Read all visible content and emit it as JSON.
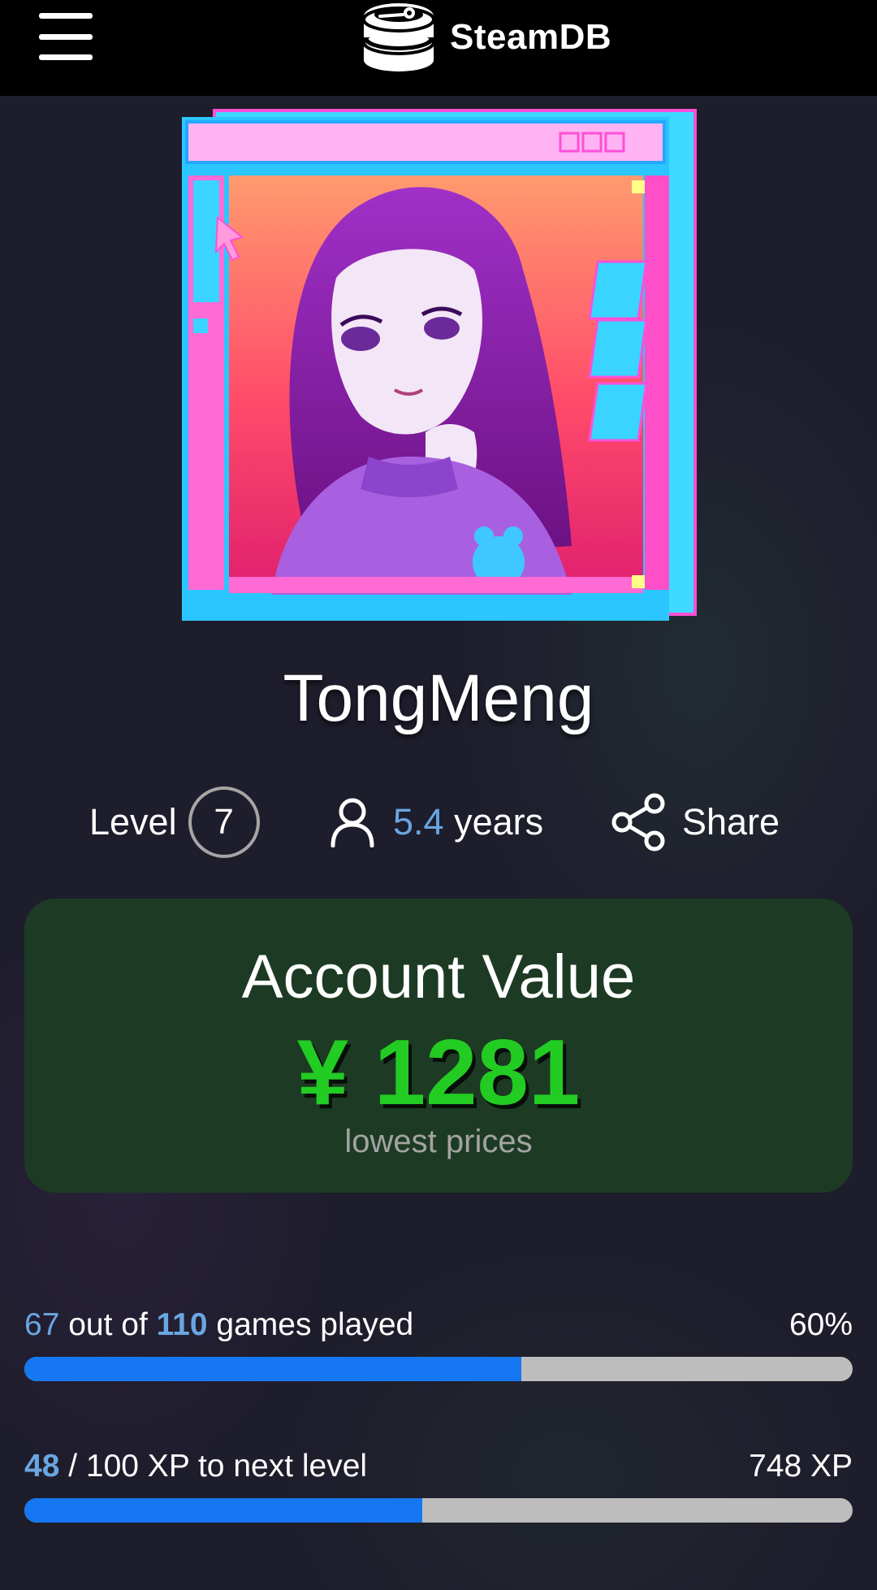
{
  "header": {
    "brand": "SteamDB",
    "menu_icon": "hamburger-menu-icon",
    "logo_icon": "steamdb-logo-icon"
  },
  "profile": {
    "username": "TongMeng",
    "level_label": "Level",
    "level": "7",
    "years_value": "5.4",
    "years_unit": " years",
    "share_label": "Share"
  },
  "account_value": {
    "title": "Account Value",
    "amount": "¥ 1281",
    "subtitle": "lowest prices",
    "color": "#22cc22"
  },
  "games_progress": {
    "played": "67",
    "out_of_text": " out of ",
    "total": "110",
    "suffix": " games played",
    "percent_text": "60%",
    "fraction": 0.6
  },
  "xp_progress": {
    "current": "48",
    "rest": " / 100 XP to next level",
    "total_xp": "748 XP",
    "fraction": 0.48
  },
  "colors": {
    "accent": "#69a6e1",
    "progress_fill": "#1677f2",
    "card_bg": "#1d3b24",
    "page_bg": "#1e1d2c"
  }
}
